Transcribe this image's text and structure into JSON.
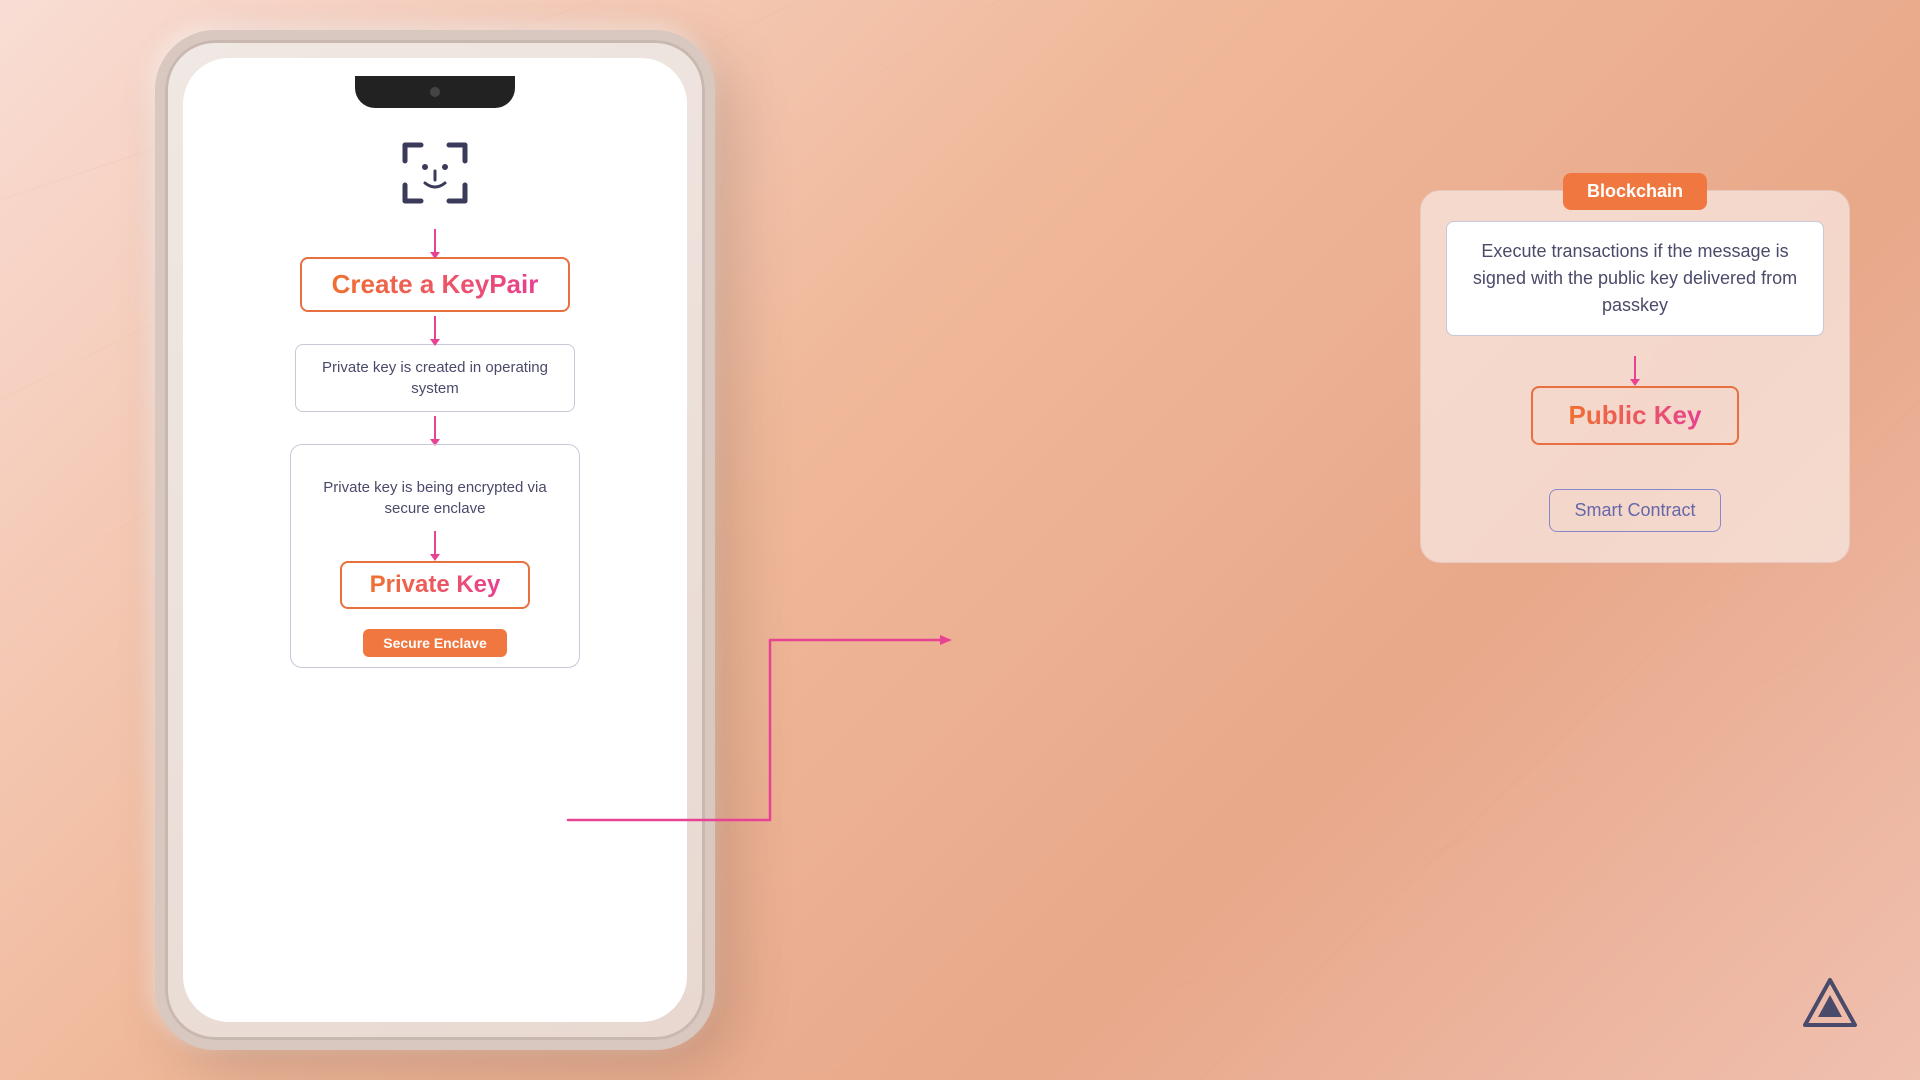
{
  "background": {
    "color_start": "#f9ddd4",
    "color_end": "#e8a88a"
  },
  "phone": {
    "screen": {
      "faceid_label": "Face ID",
      "keypair_box": {
        "label": "Create a KeyPair"
      },
      "private_key_created_box": {
        "text": "Private key is created in operating system"
      },
      "secure_enclave_group": {
        "encrypted_text": "Private key is being encrypted via secure enclave",
        "private_key_label": "Private Key",
        "secure_enclave_badge": "Secure Enclave"
      }
    }
  },
  "blockchain_panel": {
    "badge": "Blockchain",
    "info_text": "Execute transactions if the message is signed with the public key delivered from passkey",
    "public_key_label": "Public Key",
    "smart_contract_label": "Smart Contract"
  },
  "logo": {
    "alt": "Alchemy Logo"
  },
  "colors": {
    "accent_orange": "#f07840",
    "accent_pink": "#e84393",
    "gradient_start": "#f07030",
    "gradient_end": "#e84090",
    "text_blue": "#4a4a6a",
    "border_light": "#c8c8d8",
    "smart_contract_color": "#6666aa"
  }
}
